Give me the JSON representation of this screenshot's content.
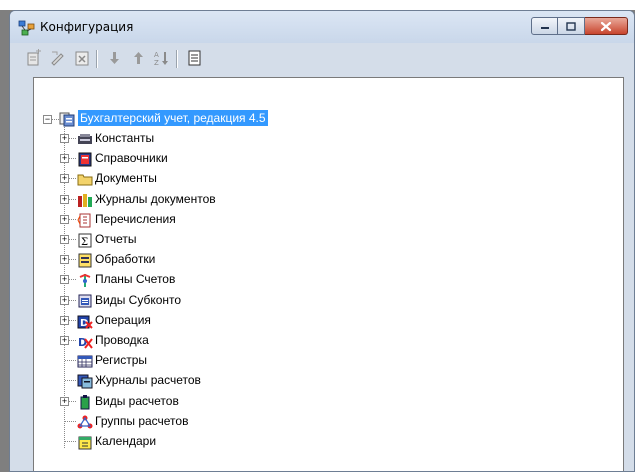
{
  "window": {
    "title": "Конфигурация"
  },
  "toolbar": {
    "buttons": [
      {
        "name": "new-object-icon"
      },
      {
        "name": "edit-object-icon"
      },
      {
        "name": "delete-object-icon"
      },
      {
        "name": "move-down-icon"
      },
      {
        "name": "move-up-icon"
      },
      {
        "name": "sort-icon"
      },
      {
        "name": "properties-icon"
      }
    ]
  },
  "tree": {
    "root": {
      "label": "Бухгалтерский учет, редакция 4.5",
      "icon": "configuration-icon",
      "expanded": true
    },
    "items": [
      {
        "label": "Константы",
        "icon": "constants-icon",
        "expandable": true
      },
      {
        "label": "Справочники",
        "icon": "catalogs-icon",
        "expandable": true
      },
      {
        "label": "Документы",
        "icon": "documents-icon",
        "expandable": true
      },
      {
        "label": "Журналы документов",
        "icon": "document-journals-icon",
        "expandable": true
      },
      {
        "label": "Перечисления",
        "icon": "enumerations-icon",
        "expandable": true
      },
      {
        "label": "Отчеты",
        "icon": "reports-icon",
        "expandable": true
      },
      {
        "label": "Обработки",
        "icon": "processing-icon",
        "expandable": true
      },
      {
        "label": "Планы Счетов",
        "icon": "chart-of-accounts-icon",
        "expandable": true
      },
      {
        "label": "Виды Субконто",
        "icon": "subconto-types-icon",
        "expandable": true
      },
      {
        "label": "Операция",
        "icon": "operation-icon",
        "expandable": true
      },
      {
        "label": "Проводка",
        "icon": "entry-icon",
        "expandable": true
      },
      {
        "label": "Регистры",
        "icon": "registers-icon",
        "expandable": false
      },
      {
        "label": "Журналы расчетов",
        "icon": "calculation-journals-icon",
        "expandable": false
      },
      {
        "label": "Виды расчетов",
        "icon": "calculation-types-icon",
        "expandable": true
      },
      {
        "label": "Группы расчетов",
        "icon": "calculation-groups-icon",
        "expandable": false
      },
      {
        "label": "Календари",
        "icon": "calendars-icon",
        "expandable": false
      }
    ]
  },
  "colors": {
    "selection": "#3399ff",
    "titlebar": "#c9d7ea",
    "close_button": "#c8452e"
  }
}
